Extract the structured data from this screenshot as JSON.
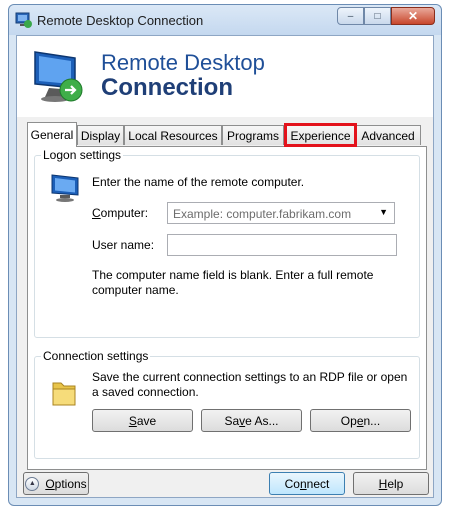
{
  "window": {
    "title": "Remote Desktop Connection",
    "minimize_glyph": "–",
    "maximize_glyph": "□",
    "close_glyph": "✕"
  },
  "banner": {
    "line1": "Remote Desktop",
    "line2": "Connection"
  },
  "tabs": [
    {
      "label": "General",
      "active": true
    },
    {
      "label": "Display"
    },
    {
      "label": "Local Resources"
    },
    {
      "label": "Programs"
    },
    {
      "label": "Experience",
      "highlighted": true
    },
    {
      "label": "Advanced"
    }
  ],
  "logon": {
    "legend": "Logon settings",
    "instruction": "Enter the name of the remote computer.",
    "computer_label_u": "C",
    "computer_label_rest": "omputer:",
    "computer_placeholder": "Example: computer.fabrikam.com",
    "username_label": "User name:",
    "username_value": "",
    "hint": "The computer name field is blank. Enter a full remote computer name."
  },
  "connection": {
    "legend": "Connection settings",
    "description": "Save the current connection settings to an RDP file or open a saved connection.",
    "save_u": "S",
    "save_rest": "ave",
    "saveas_pre": "Sa",
    "saveas_u": "v",
    "saveas_rest": "e As...",
    "open_pre": "Op",
    "open_u": "e",
    "open_rest": "n..."
  },
  "footer": {
    "options_u": "O",
    "options_rest": "ptions",
    "connect_pre": "Co",
    "connect_u": "n",
    "connect_rest": "nect",
    "help_u": "H",
    "help_rest": "elp"
  },
  "colors": {
    "highlight_border": "#e3121b",
    "banner_title": "#1f4f98"
  }
}
